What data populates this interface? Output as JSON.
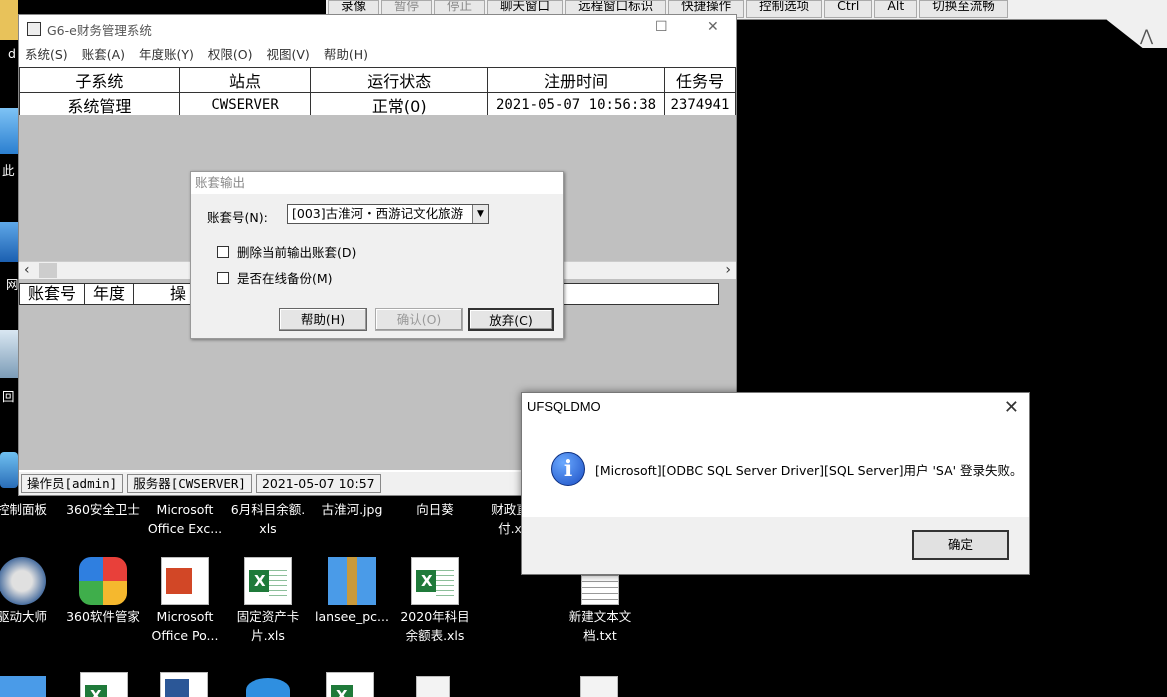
{
  "remote_toolbar": {
    "buttons": [
      "录像",
      "暂停",
      "停止",
      "聊天窗口",
      "远程窗口标识",
      "快捷操作",
      "控制选项",
      "Ctrl",
      "Alt",
      "切换至流畅"
    ]
  },
  "main_window": {
    "title": "G6-e财务管理系统",
    "menu": [
      "系统(S)",
      "账套(A)",
      "年度账(Y)",
      "权限(O)",
      "视图(V)",
      "帮助(H)"
    ],
    "table": {
      "headers": [
        "子系统",
        "站点",
        "运行状态",
        "注册时间",
        "任务号"
      ],
      "rows": [
        [
          "系统管理",
          "CWSERVER",
          "正常(0)",
          "2021-05-07 10:56:38",
          "2374941"
        ]
      ]
    },
    "lower_headers": [
      "账套号",
      "年度",
      "操"
    ],
    "status": [
      "操作员[admin]",
      "服务器[CWSERVER]",
      "2021-05-07 10:57"
    ]
  },
  "export_dialog": {
    "title": "账套输出",
    "account_label": "账套号(N):",
    "account_value": "[003]古淮河・西游记文化旅游",
    "delete_label": "删除当前输出账套(D)",
    "online_label": "是否在线备份(M)",
    "help_btn": "帮助(H)",
    "confirm_btn": "确认(O)",
    "cancel_btn": "放弃(C)"
  },
  "error_dialog": {
    "title": "UFSQLDMO",
    "message": "[Microsoft][ODBC SQL Server Driver][SQL Server]用户 'SA' 登录失败。",
    "ok_btn": "确定"
  },
  "desktop": {
    "left_labels": [
      "d",
      "此",
      "网",
      "回"
    ],
    "row1": [
      "控制面板",
      "360安全卫士",
      "Microsoft\nOffice Exc...",
      "6月科目余额.\nxls",
      "古淮河.jpg",
      "向日葵",
      "财政直\n付.x"
    ],
    "row2": [
      "驱动大师",
      "360软件管家",
      "Microsoft\nOffice Po...",
      "固定资产卡\n片.xls",
      "lansee_pc...",
      "2020年科目\n余额表.xls",
      "新建文本文\n档.txt"
    ]
  }
}
